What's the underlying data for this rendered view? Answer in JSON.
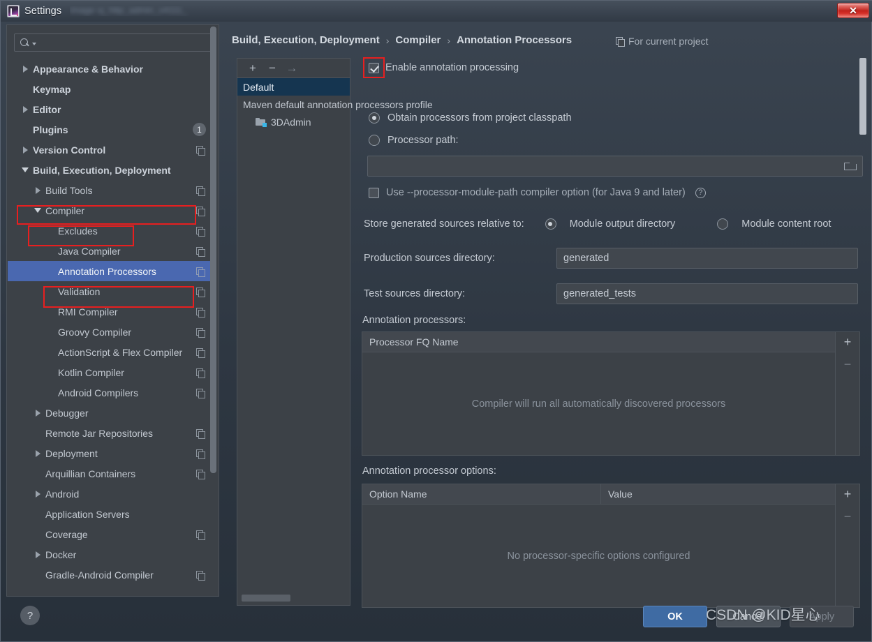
{
  "window": {
    "title": "Settings",
    "blurred_suffix": "image xj_http_admin_v4111_",
    "close_label": "✕",
    "app_icon": "intellij-idea-icon"
  },
  "sidebar": {
    "search": {
      "value": "",
      "placeholder": "",
      "icon": "search-icon"
    },
    "items": [
      {
        "label": "Appearance & Behavior",
        "level": 1,
        "arrow": "right",
        "bold": true,
        "copy": false,
        "badge": ""
      },
      {
        "label": "Keymap",
        "level": 1,
        "arrow": "none",
        "bold": true,
        "copy": false,
        "badge": ""
      },
      {
        "label": "Editor",
        "level": 1,
        "arrow": "right",
        "bold": true,
        "copy": false,
        "badge": ""
      },
      {
        "label": "Plugins",
        "level": 1,
        "arrow": "none",
        "bold": true,
        "copy": false,
        "badge": "1"
      },
      {
        "label": "Version Control",
        "level": 1,
        "arrow": "right",
        "bold": true,
        "copy": true,
        "badge": ""
      },
      {
        "label": "Build, Execution, Deployment",
        "level": 1,
        "arrow": "down",
        "bold": true,
        "copy": false,
        "badge": ""
      },
      {
        "label": "Build Tools",
        "level": 2,
        "arrow": "right",
        "bold": false,
        "copy": true,
        "badge": ""
      },
      {
        "label": "Compiler",
        "level": 2,
        "arrow": "down",
        "bold": false,
        "copy": true,
        "badge": ""
      },
      {
        "label": "Excludes",
        "level": 3,
        "arrow": "none",
        "bold": false,
        "copy": true,
        "badge": ""
      },
      {
        "label": "Java Compiler",
        "level": 3,
        "arrow": "none",
        "bold": false,
        "copy": true,
        "badge": ""
      },
      {
        "label": "Annotation Processors",
        "level": 3,
        "arrow": "none",
        "bold": false,
        "copy": true,
        "badge": "",
        "selected": true
      },
      {
        "label": "Validation",
        "level": 3,
        "arrow": "none",
        "bold": false,
        "copy": true,
        "badge": ""
      },
      {
        "label": "RMI Compiler",
        "level": 3,
        "arrow": "none",
        "bold": false,
        "copy": true,
        "badge": ""
      },
      {
        "label": "Groovy Compiler",
        "level": 3,
        "arrow": "none",
        "bold": false,
        "copy": true,
        "badge": ""
      },
      {
        "label": "ActionScript & Flex Compiler",
        "level": 3,
        "arrow": "none",
        "bold": false,
        "copy": true,
        "badge": ""
      },
      {
        "label": "Kotlin Compiler",
        "level": 3,
        "arrow": "none",
        "bold": false,
        "copy": true,
        "badge": ""
      },
      {
        "label": "Android Compilers",
        "level": 3,
        "arrow": "none",
        "bold": false,
        "copy": true,
        "badge": ""
      },
      {
        "label": "Debugger",
        "level": 2,
        "arrow": "right",
        "bold": false,
        "copy": false,
        "badge": ""
      },
      {
        "label": "Remote Jar Repositories",
        "level": 2,
        "arrow": "none",
        "bold": false,
        "copy": true,
        "badge": ""
      },
      {
        "label": "Deployment",
        "level": 2,
        "arrow": "right",
        "bold": false,
        "copy": true,
        "badge": ""
      },
      {
        "label": "Arquillian Containers",
        "level": 2,
        "arrow": "none",
        "bold": false,
        "copy": true,
        "badge": ""
      },
      {
        "label": "Android",
        "level": 2,
        "arrow": "right",
        "bold": false,
        "copy": false,
        "badge": ""
      },
      {
        "label": "Application Servers",
        "level": 2,
        "arrow": "none",
        "bold": false,
        "copy": false,
        "badge": ""
      },
      {
        "label": "Coverage",
        "level": 2,
        "arrow": "none",
        "bold": false,
        "copy": true,
        "badge": ""
      },
      {
        "label": "Docker",
        "level": 2,
        "arrow": "right",
        "bold": false,
        "copy": false,
        "badge": ""
      },
      {
        "label": "Gradle-Android Compiler",
        "level": 2,
        "arrow": "none",
        "bold": false,
        "copy": true,
        "badge": ""
      }
    ]
  },
  "header": {
    "crumbs": [
      "Build, Execution, Deployment",
      "Compiler",
      "Annotation Processors"
    ],
    "separator": "›",
    "scope_label": "For current project",
    "scope_icon": "project-scope-icon"
  },
  "profiles": {
    "toolbar": {
      "add": "+",
      "remove": "−",
      "move": "→"
    },
    "rows": [
      {
        "label": "Default",
        "selected": true,
        "child": false
      },
      {
        "label": "Maven default annotation processors profile",
        "selected": false,
        "child": false
      },
      {
        "label": "3DAdmin",
        "selected": false,
        "child": true,
        "icon": "module-icon"
      }
    ]
  },
  "main": {
    "enable_processing": {
      "label": "Enable annotation processing",
      "checked": true
    },
    "obtain_from_classpath": {
      "label": "Obtain processors from project classpath",
      "selected": true
    },
    "processor_path": {
      "label": "Processor path:",
      "selected": false,
      "value": "",
      "browse_icon": "folder-icon"
    },
    "module_path_option": {
      "label": "Use --processor-module-path compiler option (for Java 9 and later)",
      "checked": false,
      "help_icon": "help-icon",
      "help_glyph": "?"
    },
    "store_relative": {
      "label": "Store generated sources relative to:",
      "options": [
        {
          "label": "Module output directory",
          "selected": true
        },
        {
          "label": "Module content root",
          "selected": false
        }
      ]
    },
    "production_sources": {
      "label": "Production sources directory:",
      "value": "generated"
    },
    "test_sources": {
      "label": "Test sources directory:",
      "value": "generated_tests"
    },
    "processors_table": {
      "title": "Annotation processors:",
      "columns": [
        "Processor FQ Name"
      ],
      "rows": [],
      "empty_text": "Compiler will run all automatically discovered processors",
      "add_btn": "+",
      "remove_btn": "−"
    },
    "options_table": {
      "title": "Annotation processor options:",
      "columns": [
        "Option Name",
        "Value"
      ],
      "rows": [],
      "empty_text": "No processor-specific options configured",
      "add_btn": "+",
      "remove_btn": "−"
    }
  },
  "footer": {
    "help": "?",
    "ok": "OK",
    "cancel": "Cancel",
    "apply": "Apply"
  },
  "watermark": "CSDN @KID星心",
  "colors": {
    "window_bg": "#3c4147",
    "selection_blue": "#4a68b0",
    "profile_selection": "#153550",
    "highlight_red": "#e81f1f",
    "ok_button": "#3f6ba3",
    "close_button": "#c2221c",
    "module_badge": "#3ab7e8"
  }
}
